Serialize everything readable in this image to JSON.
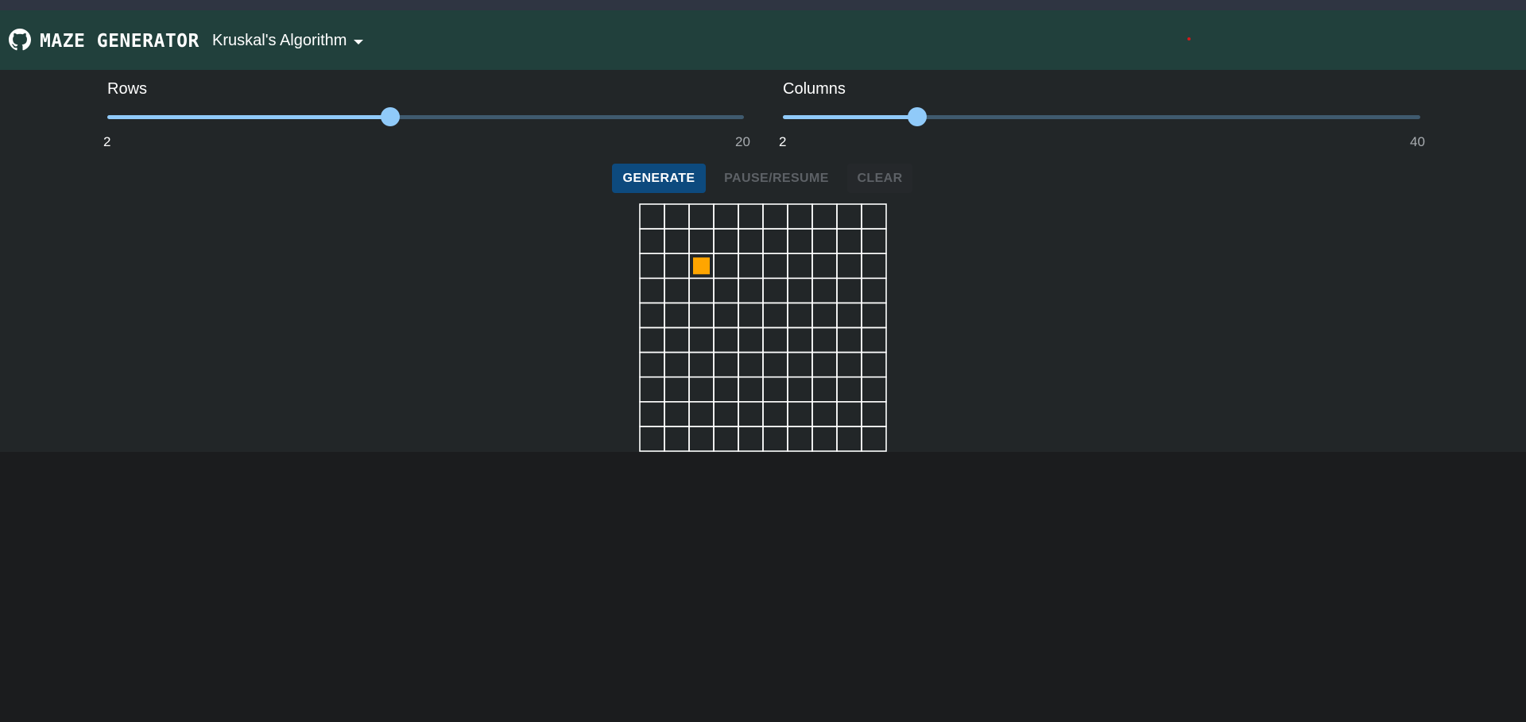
{
  "navbar": {
    "brand": "MAZE GENERATOR",
    "github_icon": "github-icon",
    "algorithm_selected": "Kruskal's Algorithm",
    "dropdown_icon": "caret-down-icon"
  },
  "sliders": {
    "rows": {
      "label": "Rows",
      "min": "2",
      "max": "20",
      "value": 10
    },
    "columns": {
      "label": "Columns",
      "min": "2",
      "max": "40",
      "value": 10
    }
  },
  "buttons": {
    "generate": "GENERATE",
    "pause_resume": "PAUSE/RESUME",
    "clear": "CLEAR"
  },
  "maze": {
    "rows": 10,
    "columns": 10,
    "highlighted_cell": {
      "row": 3,
      "column": 3
    },
    "highlight_color": "#ffa500",
    "wall_color": "#ffffff"
  },
  "colors": {
    "navbar": "#21403c",
    "accent": "#90caf9",
    "primary_button": "#0d4a7e"
  }
}
